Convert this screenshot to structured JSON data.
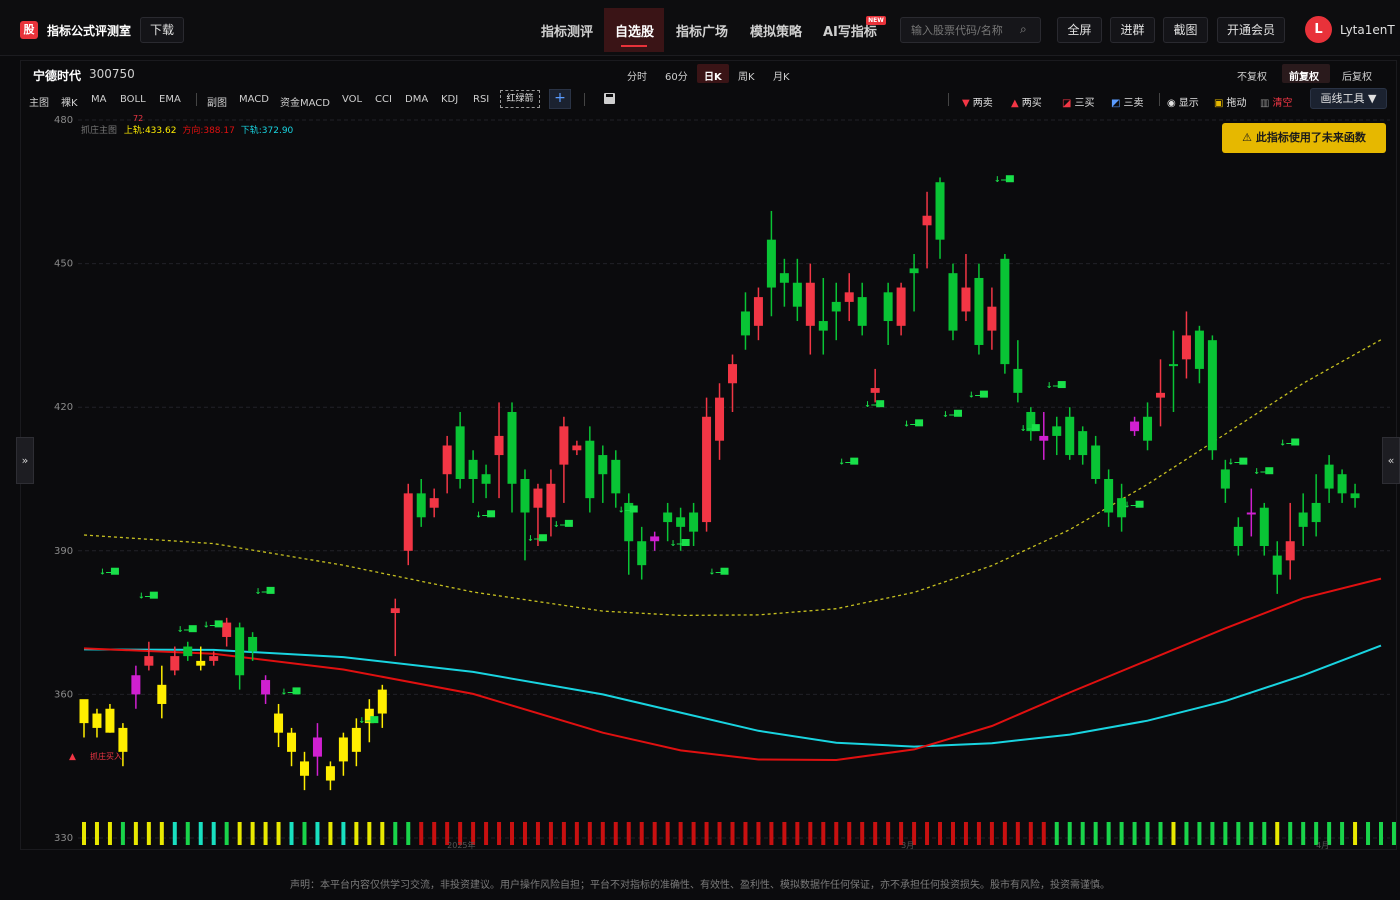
{
  "brand": {
    "logo": "股",
    "name": "指标公式评测室"
  },
  "header": {
    "download": "下载",
    "nav": [
      {
        "label": "指标测评"
      },
      {
        "label": "自选股",
        "active": true
      },
      {
        "label": "指标广场"
      },
      {
        "label": "模拟策略"
      },
      {
        "label": "AI写指标",
        "badge": "NEW"
      }
    ],
    "search_placeholder": "输入股票代码/名称",
    "search_icon": "search-icon",
    "buttons": [
      "全屏",
      "进群",
      "截图",
      "开通会员"
    ],
    "avatar_letter": "L",
    "username": "Lyta1enT"
  },
  "stock": {
    "name": "宁德时代",
    "code": "300750"
  },
  "periods": [
    "分时",
    "60分",
    "日K",
    "周K",
    "月K"
  ],
  "active_period": "日K",
  "adjust": [
    "不复权",
    "前复权",
    "后复权"
  ],
  "active_adjust": "前复权",
  "indicators_main": [
    "主图",
    "裸K",
    "MA",
    "BOLL",
    "EMA"
  ],
  "indicators_sub": [
    "副图",
    "MACD",
    "资金MACD",
    "VOL",
    "CCI",
    "DMA",
    "KDJ",
    "RSI"
  ],
  "selected_indicator": "红绿箭",
  "tools": [
    {
      "label": "两卖",
      "icon": "triangle-down-icon"
    },
    {
      "label": "两买",
      "icon": "triangle-up-icon"
    },
    {
      "label": "三买",
      "icon": "chart-up-icon"
    },
    {
      "label": "三卖",
      "icon": "chart-down-icon"
    },
    {
      "label": "显示",
      "icon": "eye-icon"
    },
    {
      "label": "拖动",
      "icon": "lock-icon"
    },
    {
      "label": "清空",
      "icon": "trash-icon"
    }
  ],
  "draw_tools": "画线工具 ▼",
  "warning": "此指标使用了未来函数",
  "legend": {
    "name": "抓庄主图",
    "upper_label": "上轨:",
    "upper": "433.62",
    "dir_label": "方向:",
    "dir": "388.17",
    "lower_label": "下轨:",
    "lower": "372.90",
    "marker": "72"
  },
  "chart_data": {
    "type": "candlestick",
    "y_ticks": [
      "480",
      "450",
      "420",
      "390",
      "360",
      "330"
    ],
    "ylim": [
      330,
      480
    ],
    "signal_text": "↓—",
    "colors": {
      "up": "#f23645",
      "down": "#09c435",
      "yellow": "#ffee00",
      "magenta": "#d020d0",
      "red_line": "#e01010",
      "cyan_line": "#19d4e0",
      "olive_line": "#c6c020"
    },
    "candles": [
      [
        354,
        359,
        351,
        355,
        "y"
      ],
      [
        356,
        353,
        351,
        357,
        "y"
      ],
      [
        352,
        357,
        352,
        358,
        "y"
      ],
      [
        348,
        353,
        345,
        354,
        "y"
      ],
      [
        364,
        360,
        357,
        366,
        "m"
      ],
      [
        366,
        368,
        365,
        371,
        "r"
      ],
      [
        362,
        358,
        355,
        366,
        "y"
      ],
      [
        365,
        368,
        364,
        370,
        "r"
      ],
      [
        370,
        368,
        367,
        371,
        "g"
      ],
      [
        367,
        366,
        365,
        370,
        "y"
      ],
      [
        368,
        367,
        366,
        369,
        "r"
      ],
      [
        372,
        375,
        370,
        376,
        "r"
      ],
      [
        374,
        364,
        361,
        375,
        "g"
      ],
      [
        372,
        369,
        367,
        373,
        "g"
      ],
      [
        363,
        360,
        358,
        364,
        "m"
      ],
      [
        356,
        352,
        349,
        358,
        "y"
      ],
      [
        352,
        348,
        345,
        353,
        "y"
      ],
      [
        346,
        343,
        340,
        348,
        "y"
      ],
      [
        351,
        347,
        343,
        354,
        "m"
      ],
      [
        345,
        342,
        340,
        346,
        "y"
      ],
      [
        346,
        351,
        343,
        352,
        "y"
      ],
      [
        348,
        353,
        345,
        355,
        "y"
      ],
      [
        354,
        357,
        350,
        359,
        "y"
      ],
      [
        356,
        361,
        353,
        362,
        "y"
      ],
      [
        378,
        377,
        368,
        380,
        "r"
      ],
      [
        390,
        402,
        387,
        404,
        "r"
      ],
      [
        402,
        397,
        395,
        405,
        "g"
      ],
      [
        399,
        401,
        397,
        403,
        "r"
      ],
      [
        406,
        412,
        402,
        414,
        "r"
      ],
      [
        416,
        405,
        403,
        419,
        "g"
      ],
      [
        409,
        405,
        400,
        411,
        "g"
      ],
      [
        406,
        404,
        401,
        408,
        "g"
      ],
      [
        410,
        414,
        401,
        421,
        "r"
      ],
      [
        419,
        404,
        398,
        421,
        "g"
      ],
      [
        405,
        398,
        388,
        407,
        "g"
      ],
      [
        399,
        403,
        391,
        404,
        "r"
      ],
      [
        404,
        397,
        393,
        407,
        "r"
      ],
      [
        416,
        408,
        400,
        418,
        "r"
      ],
      [
        412,
        411,
        410,
        413,
        "r"
      ],
      [
        413,
        401,
        398,
        416,
        "g"
      ],
      [
        410,
        406,
        400,
        412,
        "g"
      ],
      [
        409,
        402,
        399,
        411,
        "g"
      ],
      [
        400,
        392,
        385,
        402,
        "g"
      ],
      [
        392,
        387,
        384,
        395,
        "g"
      ],
      [
        392,
        393,
        390,
        394,
        "m"
      ],
      [
        398,
        396,
        392,
        400,
        "g"
      ],
      [
        397,
        395,
        390,
        399,
        "g"
      ],
      [
        394,
        398,
        391,
        400,
        "g"
      ],
      [
        396,
        418,
        394,
        422,
        "r"
      ],
      [
        413,
        422,
        409,
        425,
        "r"
      ],
      [
        425,
        429,
        419,
        431,
        "r"
      ],
      [
        435,
        440,
        432,
        444,
        "g"
      ],
      [
        437,
        443,
        434,
        445,
        "r"
      ],
      [
        455,
        445,
        439,
        461,
        "g"
      ],
      [
        446,
        448,
        441,
        451,
        "g"
      ],
      [
        446,
        441,
        438,
        451,
        "g"
      ],
      [
        437,
        446,
        431,
        450,
        "r"
      ],
      [
        438,
        436,
        431,
        447,
        "g"
      ],
      [
        440,
        442,
        434,
        446,
        "g"
      ],
      [
        442,
        444,
        438,
        448,
        "r"
      ],
      [
        443,
        437,
        435,
        446,
        "g"
      ],
      [
        423,
        424,
        421,
        428,
        "r"
      ],
      [
        438,
        444,
        433,
        446,
        "g"
      ],
      [
        437,
        445,
        435,
        446,
        "r"
      ],
      [
        449,
        448,
        440,
        452,
        "g"
      ],
      [
        458,
        460,
        449,
        465,
        "r"
      ],
      [
        467,
        455,
        451,
        468,
        "g"
      ],
      [
        448,
        436,
        434,
        450,
        "g"
      ],
      [
        445,
        440,
        438,
        452,
        "r"
      ],
      [
        447,
        433,
        431,
        450,
        "g"
      ],
      [
        441,
        436,
        432,
        445,
        "r"
      ],
      [
        451,
        429,
        427,
        452,
        "g"
      ],
      [
        428,
        423,
        421,
        434,
        "g"
      ],
      [
        419,
        415,
        413,
        420,
        "g"
      ],
      [
        414,
        413,
        409,
        419,
        "m"
      ],
      [
        416,
        414,
        410,
        418,
        "g"
      ],
      [
        418,
        410,
        409,
        420,
        "g"
      ],
      [
        415,
        410,
        408,
        416,
        "g"
      ],
      [
        412,
        405,
        404,
        414,
        "g"
      ],
      [
        405,
        398,
        395,
        407,
        "g"
      ],
      [
        401,
        397,
        394,
        404,
        "g"
      ],
      [
        417,
        415,
        414,
        418,
        "m"
      ],
      [
        413,
        418,
        411,
        421,
        "g"
      ],
      [
        422,
        423,
        416,
        430,
        "r"
      ],
      [
        429,
        429,
        419,
        436,
        "g"
      ],
      [
        430,
        435,
        426,
        440,
        "r"
      ],
      [
        436,
        428,
        425,
        437,
        "g"
      ],
      [
        434,
        411,
        409,
        435,
        "g"
      ],
      [
        407,
        403,
        400,
        409,
        "g"
      ],
      [
        395,
        391,
        389,
        397,
        "g"
      ],
      [
        398,
        398,
        393,
        403,
        "m"
      ],
      [
        399,
        391,
        389,
        400,
        "g"
      ],
      [
        389,
        385,
        381,
        392,
        "g"
      ],
      [
        392,
        388,
        384,
        400,
        "r"
      ],
      [
        398,
        395,
        391,
        402,
        "g"
      ],
      [
        400,
        396,
        393,
        406,
        "g"
      ],
      [
        403,
        408,
        400,
        410,
        "g"
      ],
      [
        406,
        402,
        400,
        407,
        "g"
      ],
      [
        402,
        401,
        399,
        404,
        "g"
      ]
    ],
    "signals": [
      [
        2,
        385
      ],
      [
        5,
        380
      ],
      [
        8,
        373
      ],
      [
        10,
        374
      ],
      [
        14,
        381
      ],
      [
        16,
        360
      ],
      [
        22,
        354
      ],
      [
        31,
        397
      ],
      [
        35,
        392
      ],
      [
        37,
        395
      ],
      [
        42,
        398
      ],
      [
        46,
        391
      ],
      [
        49,
        385
      ],
      [
        59,
        408
      ],
      [
        61,
        420
      ],
      [
        64,
        416
      ],
      [
        67,
        418
      ],
      [
        69,
        422
      ],
      [
        71,
        467
      ],
      [
        73,
        415
      ],
      [
        75,
        424
      ],
      [
        81,
        399
      ],
      [
        89,
        408
      ],
      [
        91,
        406
      ],
      [
        93,
        412
      ]
    ],
    "buy_signal": {
      "index": 0,
      "label": "抓庄买入"
    },
    "lines": {
      "red": [
        [
          0,
          369.6
        ],
        [
          10,
          368.5
        ],
        [
          20,
          365.2
        ],
        [
          30,
          360.1
        ],
        [
          40,
          352.0
        ],
        [
          46,
          348.3
        ],
        [
          52,
          346.4
        ],
        [
          58,
          346.3
        ],
        [
          64,
          348.5
        ],
        [
          70,
          353.4
        ],
        [
          76,
          360.4
        ],
        [
          82,
          367.1
        ],
        [
          88,
          373.8
        ],
        [
          94,
          380.1
        ],
        [
          100,
          384.2
        ]
      ],
      "cyan": [
        [
          0,
          369.4
        ],
        [
          10,
          369.3
        ],
        [
          20,
          367.8
        ],
        [
          30,
          364.7
        ],
        [
          40,
          360.0
        ],
        [
          46,
          356.2
        ],
        [
          52,
          352.4
        ],
        [
          58,
          349.9
        ],
        [
          64,
          349.1
        ],
        [
          70,
          349.8
        ],
        [
          76,
          351.6
        ],
        [
          82,
          354.5
        ],
        [
          88,
          358.6
        ],
        [
          94,
          364.0
        ],
        [
          100,
          370.2
        ]
      ],
      "olive": [
        [
          0,
          393.3
        ],
        [
          10,
          391.5
        ],
        [
          20,
          387.0
        ],
        [
          30,
          381.4
        ],
        [
          40,
          377.4
        ],
        [
          46,
          376.5
        ],
        [
          52,
          376.6
        ],
        [
          58,
          377.9
        ],
        [
          64,
          381.3
        ],
        [
          70,
          386.9
        ],
        [
          76,
          394.4
        ],
        [
          82,
          403.9
        ],
        [
          88,
          414.4
        ],
        [
          94,
          425.0
        ],
        [
          100,
          434.1
        ]
      ]
    },
    "volume_colors": "yyygyyymgmmgyyyymgmymyyyggrrrrrrrrrrrrrrrrrrrrrrrrrrrrrrrrrrrrrrrrrrrrrrrrrgggggggggygggggggygggggyggggg",
    "x_labels": [
      "2025年",
      "3月",
      "4月"
    ]
  },
  "disclaimer": "声明：本平台内容仅供学习交流，非投资建议。用户操作风险自担；平台不对指标的准确性、有效性、盈利性、模拟数据作任何保证，亦不承担任何投资损失。股市有风险，投资需谨慎。"
}
